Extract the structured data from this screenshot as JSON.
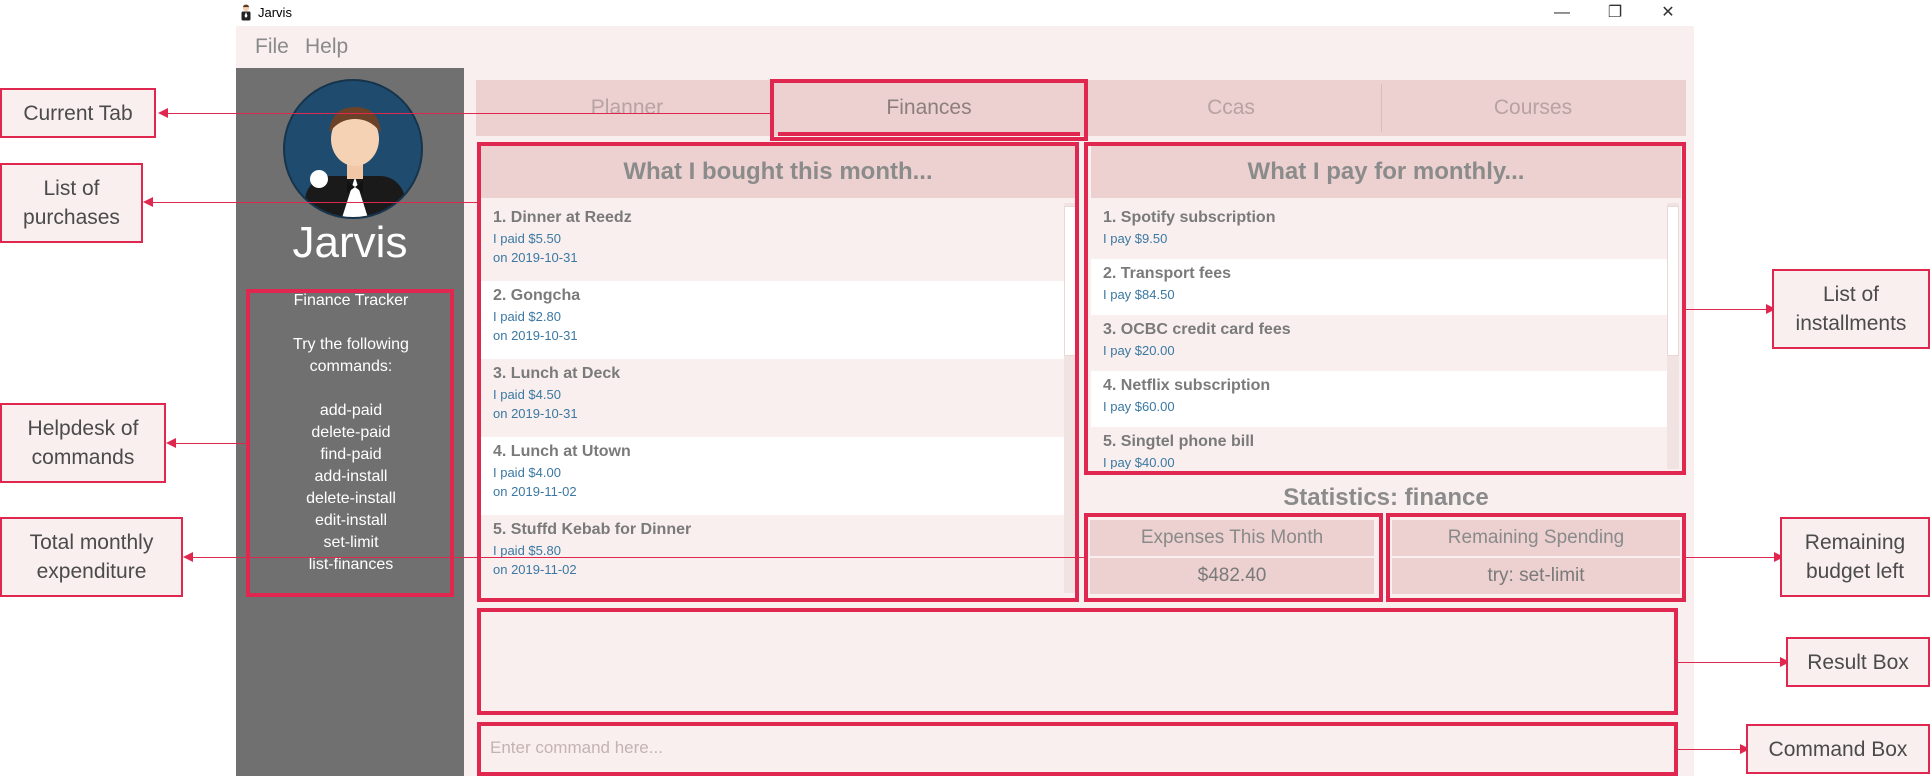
{
  "window": {
    "title": "Jarvis",
    "minimize": "—",
    "restore": "❐",
    "close": "✕"
  },
  "menu": {
    "file": "File",
    "help": "Help"
  },
  "sidebar": {
    "brand": "Jarvis",
    "help_title": "Finance Tracker",
    "help_intro": "Try the following commands:",
    "commands": [
      "add-paid",
      "delete-paid",
      "find-paid",
      "add-install",
      "delete-install",
      "edit-install",
      "set-limit",
      "list-finances"
    ]
  },
  "tabs": [
    "Planner",
    "Finances",
    "Ccas",
    "Courses"
  ],
  "purchases": {
    "title": "What I bought this month...",
    "items": [
      {
        "title": "1.  Dinner at Reedz",
        "paid": "I paid $5.50",
        "date": "on 2019-10-31"
      },
      {
        "title": "2.  Gongcha",
        "paid": "I paid $2.80",
        "date": "on 2019-10-31"
      },
      {
        "title": "3.  Lunch at Deck",
        "paid": "I paid $4.50",
        "date": "on 2019-10-31"
      },
      {
        "title": "4.  Lunch at Utown",
        "paid": "I paid $4.00",
        "date": "on 2019-11-02"
      },
      {
        "title": "5.  Stuffd Kebab for Dinner",
        "paid": "I paid $5.80",
        "date": "on 2019-11-02"
      }
    ]
  },
  "installments": {
    "title": "What I pay for monthly...",
    "items": [
      {
        "title": "1.  Spotify subscription",
        "pay": "I pay $9.50"
      },
      {
        "title": "2.  Transport fees",
        "pay": "I pay $84.50"
      },
      {
        "title": "3.  OCBC credit card fees",
        "pay": "I pay $20.00"
      },
      {
        "title": "4.  Netflix subscription",
        "pay": "I pay $60.00"
      },
      {
        "title": "5.  Singtel phone bill",
        "pay": "I pay $40.00"
      }
    ]
  },
  "statistics": {
    "title": "Statistics: finance",
    "expenses_label": "Expenses This Month",
    "expenses_value": "$482.40",
    "remaining_label": "Remaining Spending",
    "remaining_value": "try: set-limit"
  },
  "command": {
    "placeholder": "Enter command here..."
  },
  "annotations": {
    "current_tab": "Current Tab",
    "list_purchases": "List of purchases",
    "helpdesk": "Helpdesk of commands",
    "total_monthly": "Total monthly expenditure",
    "list_installments": "List of installments",
    "remaining_budget": "Remaining budget left",
    "result_box": "Result Box",
    "command_box": "Command Box"
  },
  "colors": {
    "accent": "#e0274f",
    "panel": "#ecd1d0",
    "background": "#f8efee",
    "sidebar": "#707070"
  }
}
